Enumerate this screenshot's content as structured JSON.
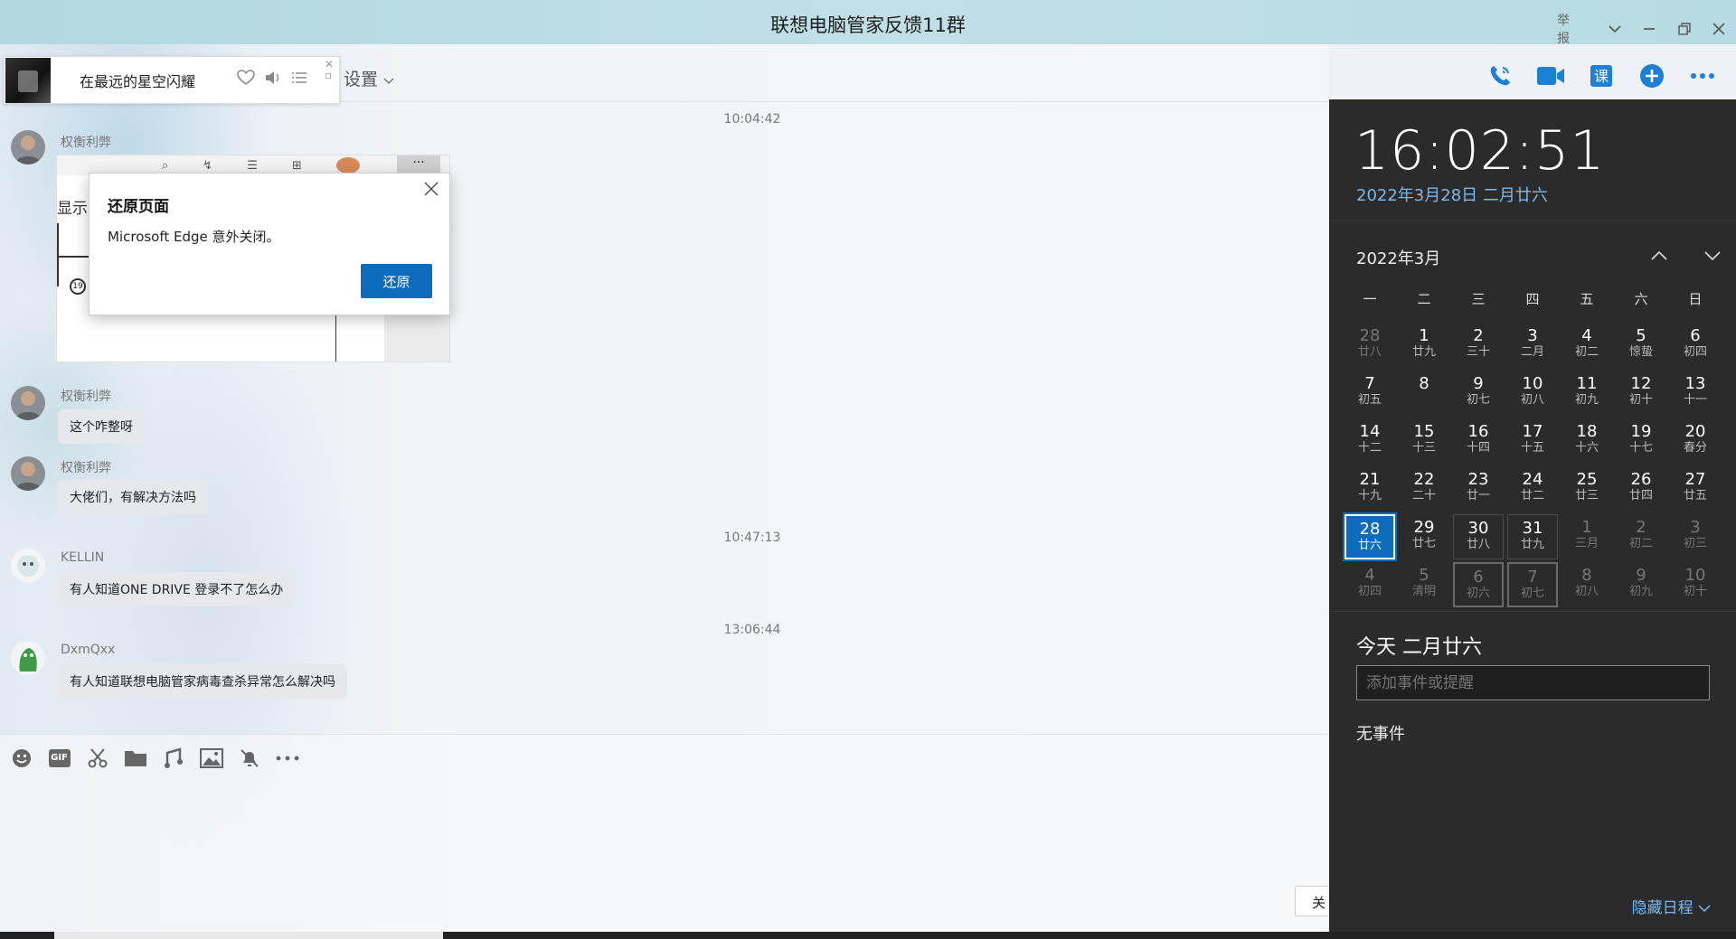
{
  "window": {
    "title": "联想电脑管家反馈11群",
    "report_label": "举报",
    "controls": [
      "chevron-down",
      "minimize",
      "restore",
      "close"
    ]
  },
  "toolbar": {
    "settings_label": "设置",
    "icons": [
      "phone-icon",
      "video-icon",
      "class-icon",
      "add-icon",
      "more-icon"
    ],
    "class_glyph": "课"
  },
  "music": {
    "song": "在最远的星空闪耀"
  },
  "messages": {
    "ts1": "10:04:42",
    "m1_name": "权衡利弊",
    "shot_show_text": "显示",
    "m2_name": "权衡利弊",
    "m2_text": "这个咋整呀",
    "m3_name": "权衡利弊",
    "m3_text": "大佬们，有解决方法吗",
    "ts2": "10:47:13",
    "m4_name": "KELLIN",
    "m4_text": "有人知道ONE DRIVE 登录不了怎么办",
    "ts3": "13:06:44",
    "m5_name": "DxmQxx",
    "m5_text": "有人知道联想电脑管家病毒查杀异常怎么解决吗"
  },
  "dialog": {
    "title": "还原页面",
    "text": "Microsoft Edge 意外关闭。",
    "button": "还原"
  },
  "input": {
    "tools": [
      "emoji-icon",
      "gif-icon",
      "scissors-icon",
      "folder-icon",
      "music-note-icon",
      "image-icon",
      "mute-bell-icon",
      "more-icon"
    ],
    "gif_label": "GIF",
    "close_label": "关"
  },
  "calendar": {
    "time": "16:02:51",
    "full_date": "2022年3月28日 二月廿六",
    "month_label": "2022年3月",
    "weekdays": [
      "一",
      "二",
      "三",
      "四",
      "五",
      "六",
      "日"
    ],
    "weeks": [
      [
        [
          "28",
          "廿八",
          "o"
        ],
        [
          "1",
          "廿九",
          ""
        ],
        [
          "2",
          "三十",
          ""
        ],
        [
          "3",
          "二月",
          ""
        ],
        [
          "4",
          "初二",
          ""
        ],
        [
          "5",
          "惊蛰",
          ""
        ],
        [
          "6",
          "初四",
          ""
        ]
      ],
      [
        [
          "7",
          "初五",
          ""
        ],
        [
          "8",
          "",
          ""
        ],
        [
          "9",
          "初七",
          ""
        ],
        [
          "10",
          "初八",
          ""
        ],
        [
          "11",
          "初九",
          ""
        ],
        [
          "12",
          "初十",
          ""
        ],
        [
          "13",
          "十一",
          ""
        ]
      ],
      [
        [
          "14",
          "十二",
          ""
        ],
        [
          "15",
          "十三",
          ""
        ],
        [
          "16",
          "十四",
          ""
        ],
        [
          "17",
          "十五",
          ""
        ],
        [
          "18",
          "十六",
          ""
        ],
        [
          "19",
          "十七",
          ""
        ],
        [
          "20",
          "春分",
          ""
        ]
      ],
      [
        [
          "21",
          "十九",
          ""
        ],
        [
          "22",
          "二十",
          ""
        ],
        [
          "23",
          "廿一",
          ""
        ],
        [
          "24",
          "廿二",
          ""
        ],
        [
          "25",
          "廿三",
          ""
        ],
        [
          "26",
          "廿四",
          ""
        ],
        [
          "27",
          "廿五",
          ""
        ]
      ],
      [
        [
          "28",
          "廿六",
          "t"
        ],
        [
          "29",
          "廿七",
          ""
        ],
        [
          "30",
          "廿八",
          "b"
        ],
        [
          "31",
          "廿九",
          "b"
        ],
        [
          "1",
          "三月",
          "o"
        ],
        [
          "2",
          "初二",
          "o"
        ],
        [
          "3",
          "初三",
          "o"
        ]
      ],
      [
        [
          "4",
          "初四",
          "o"
        ],
        [
          "5",
          "清明",
          "o"
        ],
        [
          "6",
          "初六",
          "ob"
        ],
        [
          "7",
          "初七",
          "ob"
        ],
        [
          "8",
          "初八",
          "o"
        ],
        [
          "9",
          "初九",
          "o"
        ],
        [
          "10",
          "初十",
          "o"
        ]
      ]
    ],
    "today_title": "今天 二月廿六",
    "event_placeholder": "添加事件或提醒",
    "no_event": "无事件",
    "hide_label": "隐藏日程"
  }
}
